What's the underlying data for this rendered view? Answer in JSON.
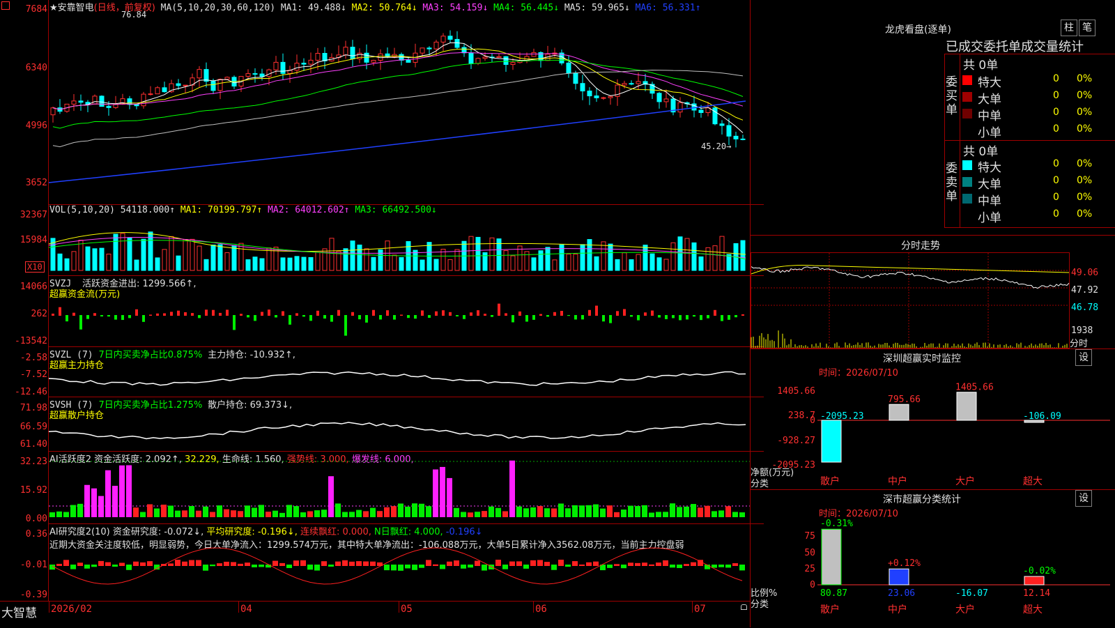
{
  "stock": {
    "name": "安靠智电",
    "mode": "(日线，前复权)",
    "star": "★",
    "brand": "大智慧"
  },
  "price_panel": {
    "axis": [
      "7684",
      "6340",
      "4996",
      "3652"
    ],
    "ma_label": "MA(5,10,20,30,60,120)",
    "ma1": "MA1: 49.488↓",
    "ma2": "MA2: 50.764↓",
    "ma3": "MA3: 54.159↓",
    "ma4": "MA4: 56.445↓",
    "ma5": "MA5: 59.965↓",
    "ma6": "MA6: 56.331↑",
    "high_label": "76.84",
    "low_label": "45.20→"
  },
  "vol_panel": {
    "axis": [
      "32367",
      "15984",
      "X10"
    ],
    "label": "VOL(5,10,20)",
    "v": "54118.000↑",
    "ma1": "MA1: 70199.797↑",
    "ma2": "MA2: 64012.602↑",
    "ma3": "MA3: 66492.500↓"
  },
  "svzj": {
    "axis": [
      "14066",
      "262",
      "-13542"
    ],
    "name": "SVZJ",
    "line1": "活跃资金进出: 1299.566↑,",
    "line2": "超赢资金流(万元)"
  },
  "svzl": {
    "axis": [
      "-2.58",
      "-7.52",
      "-12.46"
    ],
    "name": "SVZL (7)",
    "ratio": "7日内买卖净占比0.875%",
    "hold": "主力持仓: -10.932↑,",
    "line2": "超赢主力持仓"
  },
  "svsh": {
    "axis": [
      "71.98",
      "66.59",
      "61.40"
    ],
    "name": "SVSH (7)",
    "ratio": "7日内买卖净占比1.275%",
    "hold": "散户持仓: 69.373↓,",
    "line2": "超赢散户持仓"
  },
  "ai_act": {
    "axis": [
      "32.23",
      "15.92",
      "0.00"
    ],
    "name": "AI活跃度2",
    "a": "资金活跃度: 2.092↑,",
    "b": "32.229,",
    "c": "生命线: 1.560,",
    "d": "强势线: 3.000,",
    "e": "爆发线: 6.000,"
  },
  "ai_res": {
    "axis": [
      "0.36",
      "-0.01",
      "-0.39"
    ],
    "name": "AI研究度2(10)",
    "a": "资金研究度: -0.072↓,",
    "b": "平均研究度: -0.196↓,",
    "c": "连续飘红: 0.000,",
    "d": "N日飘红: 4.000,",
    "e": "-0.196↓",
    "note": "近期大资金关注度较低，明显弱势，今日大单净流入：1299.574万元，其中特大单净流出：-106.088万元，大单5日累计净入3562.08万元，当前主力控盘弱"
  },
  "time_axis": [
    "2026/02",
    "04",
    "05",
    "06",
    "07"
  ],
  "dragon": {
    "title": "龙虎看盘(逐单)",
    "btn_zhu": "柱",
    "btn_bi": "笔",
    "tabs": [
      "已成交委托单成交量统计"
    ],
    "buy_label": "委买单",
    "sell_label": "委卖单",
    "buy_total": "共 0单",
    "sell_total": "共 0单",
    "buy_rows": [
      {
        "name": "特大",
        "v": "0",
        "p": "0%",
        "color": "#ff0000"
      },
      {
        "name": "大单",
        "v": "0",
        "p": "0%",
        "color": "#a00000"
      },
      {
        "name": "中单",
        "v": "0",
        "p": "0%",
        "color": "#700000"
      },
      {
        "name": "小单",
        "v": "0",
        "p": "0%",
        "color": ""
      }
    ],
    "sell_rows": [
      {
        "name": "特大",
        "v": "0",
        "p": "0%",
        "color": "#00ffff"
      },
      {
        "name": "大单",
        "v": "0",
        "p": "0%",
        "color": "#008080"
      },
      {
        "name": "中单",
        "v": "0",
        "p": "0%",
        "color": "#006870"
      },
      {
        "name": "小单",
        "v": "0",
        "p": "0%",
        "color": ""
      }
    ]
  },
  "intraday": {
    "title": "分时走势",
    "prices": [
      "49.06",
      "47.92",
      "46.78"
    ],
    "vol": "1938",
    "unit": "分时"
  },
  "monitor": {
    "title": "深圳超赢实时监控",
    "btn": "设",
    "time": "时间：2026/07/10",
    "axis": [
      "1405.66",
      "238.7",
      "0",
      "-928.27",
      "-2095.23"
    ],
    "ylabel": "净额(万元)",
    "xlabel": "分类",
    "values": [
      "-2095.23",
      "795.66",
      "1405.66",
      "-106.09"
    ],
    "cats": [
      "散户",
      "中户",
      "大户",
      "超大"
    ]
  },
  "classify": {
    "title": "深市超赢分类统计",
    "btn": "设",
    "time": "时间：2026/07/10",
    "axis": [
      "75",
      "50",
      "25",
      "0"
    ],
    "ylabel": "比例%",
    "xlabel": "分类",
    "top": [
      "-0.31%",
      "+0.12%",
      "-0.02%"
    ],
    "bottom": [
      "80.87",
      "23.06",
      "-16.07",
      "12.14"
    ],
    "cats": [
      "散户",
      "中户",
      "大户",
      "超大"
    ]
  }
}
